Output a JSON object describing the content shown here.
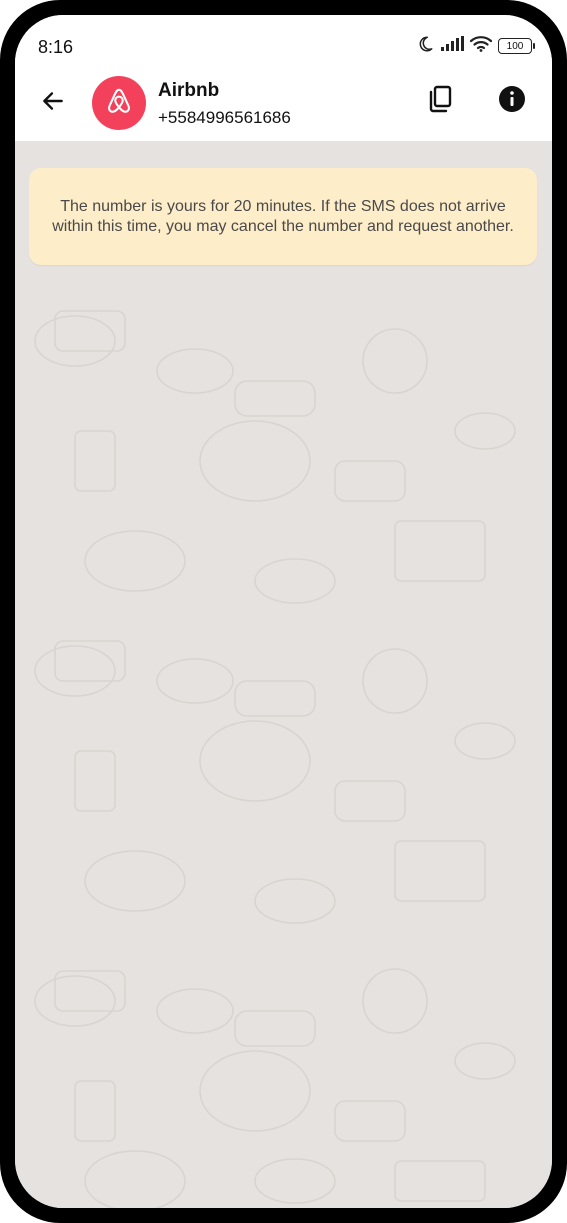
{
  "status_bar": {
    "time": "8:16",
    "battery": "100"
  },
  "header": {
    "title": "Airbnb",
    "phone_number": "+5584996561686"
  },
  "notice": {
    "text": "The number is yours for 20 minutes. If the SMS does not arrive within this time, you may cancel the number and request another."
  },
  "colors": {
    "avatar_bg": "#f3415b",
    "notice_bg": "#fdedc9",
    "chat_bg": "#e5e2df"
  },
  "icons": {
    "back": "arrow-left-icon",
    "avatar": "airbnb-logo-icon",
    "copy": "copy-icon",
    "info": "info-icon"
  }
}
